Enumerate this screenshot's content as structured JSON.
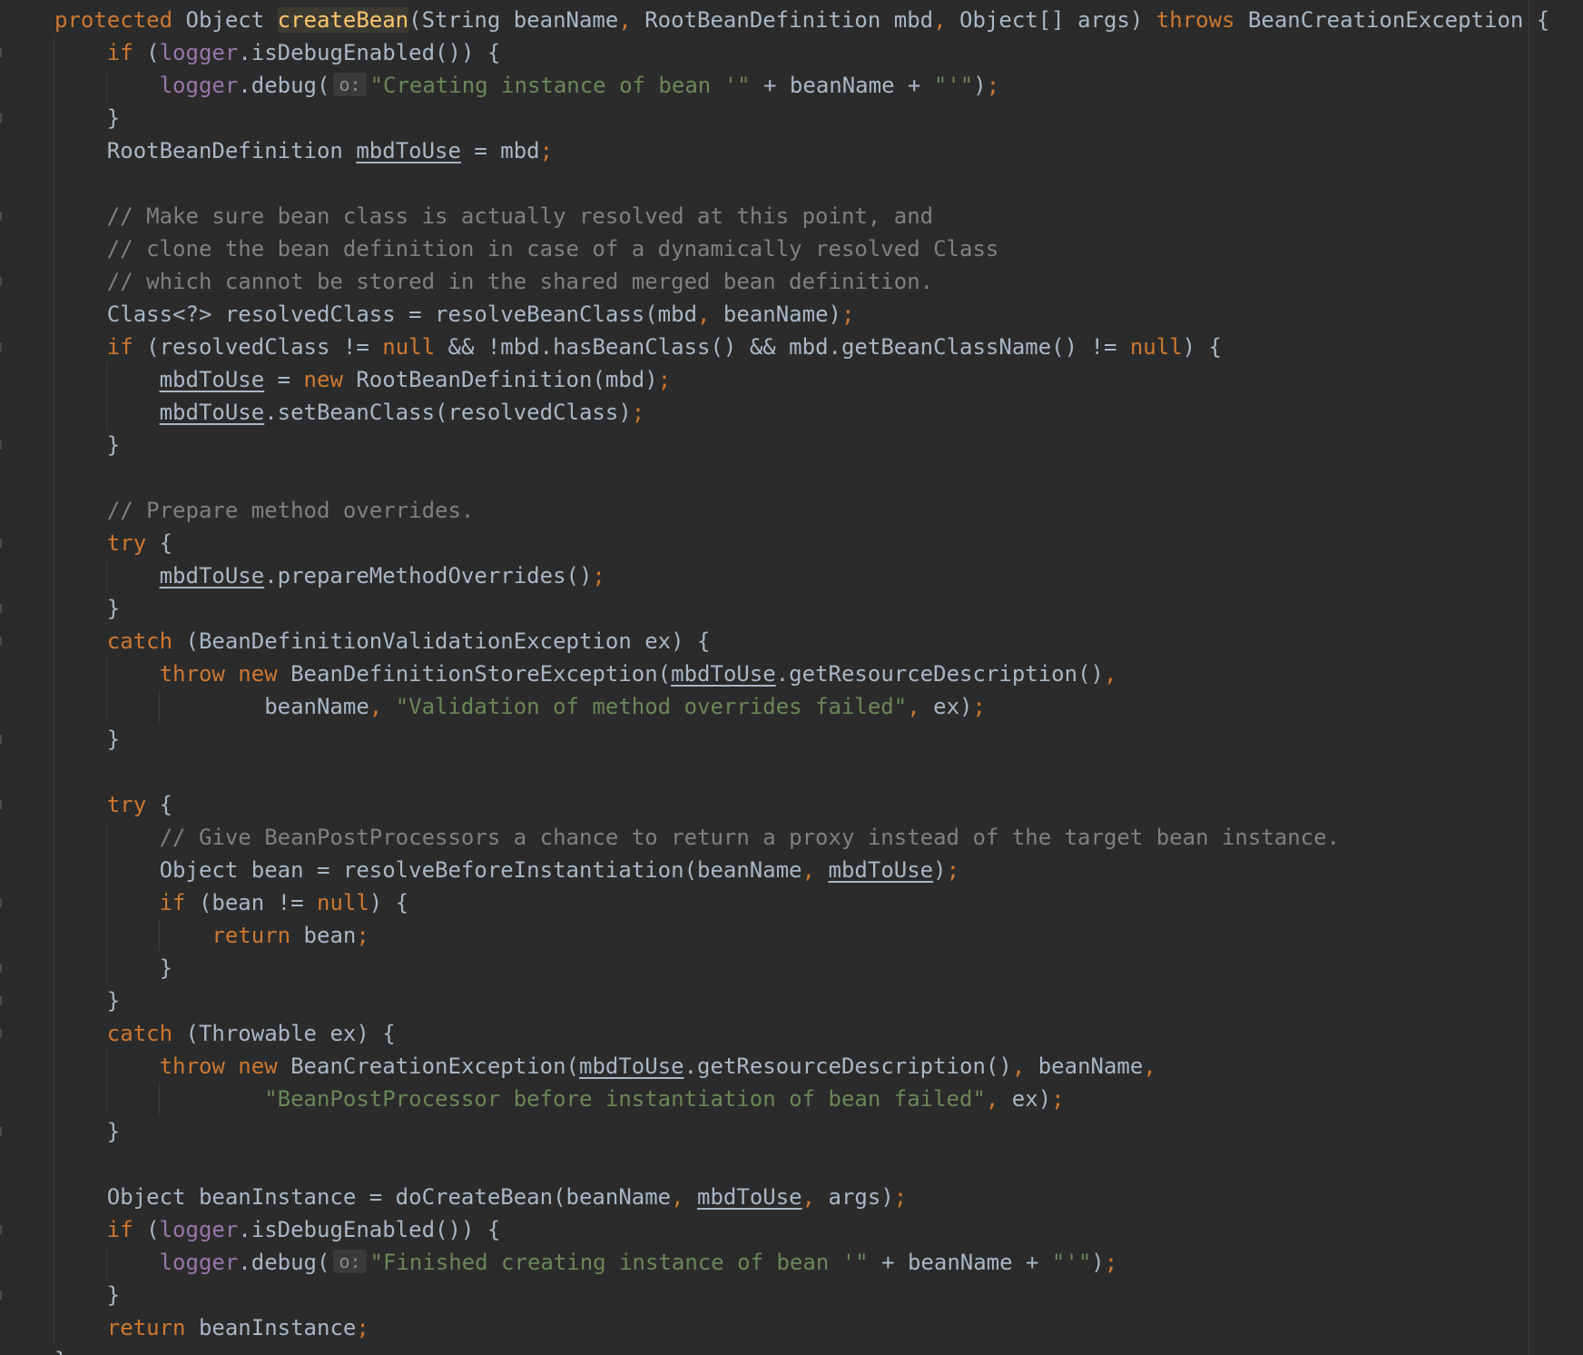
{
  "editor": {
    "language": "java",
    "theme_colors": {
      "background": "#2b2b2b",
      "keyword": "#cc7832",
      "string": "#6a8759",
      "comment": "#808080",
      "field": "#9876aa",
      "method_declaration": "#ffc66d",
      "default_text": "#a9b7c6"
    },
    "lines": [
      {
        "indent": 0,
        "guides": [],
        "fold": false,
        "tokens": [
          {
            "t": "protected",
            "c": "kw"
          },
          {
            "t": " Object "
          },
          {
            "t": "createBean",
            "c": "fn-hl"
          },
          {
            "t": "(String beanName"
          },
          {
            "t": ",",
            "c": "kw"
          },
          {
            "t": " RootBeanDefinition mbd"
          },
          {
            "t": ",",
            "c": "kw"
          },
          {
            "t": " Object[] args) "
          },
          {
            "t": "throws",
            "c": "kw"
          },
          {
            "t": " BeanCreationException {"
          }
        ]
      },
      {
        "indent": 4,
        "guides": [
          0
        ],
        "fold": true,
        "tokens": [
          {
            "t": "if",
            "c": "kw"
          },
          {
            "t": " ("
          },
          {
            "t": "logger",
            "c": "fld"
          },
          {
            "t": ".isDebugEnabled()) {"
          }
        ]
      },
      {
        "indent": 8,
        "guides": [
          0,
          4
        ],
        "fold": false,
        "tokens": [
          {
            "t": "logger",
            "c": "fld"
          },
          {
            "t": ".debug("
          },
          {
            "t": "o:",
            "c": "hint"
          },
          {
            "t": "\"Creating instance of bean '\"",
            "c": "str"
          },
          {
            "t": " + beanName + "
          },
          {
            "t": "\"'\"",
            "c": "str"
          },
          {
            "t": ")"
          },
          {
            "t": ";",
            "c": "kw"
          }
        ]
      },
      {
        "indent": 4,
        "guides": [
          0
        ],
        "fold": true,
        "tokens": [
          {
            "t": "}"
          }
        ]
      },
      {
        "indent": 4,
        "guides": [
          0
        ],
        "fold": false,
        "tokens": [
          {
            "t": "RootBeanDefinition "
          },
          {
            "t": "mbdToUse",
            "c": "ref"
          },
          {
            "t": " = mbd"
          },
          {
            "t": ";",
            "c": "kw"
          }
        ]
      },
      {
        "indent": 0,
        "guides": [
          0
        ],
        "fold": false,
        "tokens": []
      },
      {
        "indent": 4,
        "guides": [
          0
        ],
        "fold": true,
        "tokens": [
          {
            "t": "// Make sure bean class is actually resolved at this point, and",
            "c": "cmt"
          }
        ]
      },
      {
        "indent": 4,
        "guides": [
          0
        ],
        "fold": false,
        "tokens": [
          {
            "t": "// clone the bean definition in case of a dynamically resolved Class",
            "c": "cmt"
          }
        ]
      },
      {
        "indent": 4,
        "guides": [
          0
        ],
        "fold": true,
        "tokens": [
          {
            "t": "// which cannot be stored in the shared merged bean definition.",
            "c": "cmt"
          }
        ]
      },
      {
        "indent": 4,
        "guides": [
          0
        ],
        "fold": false,
        "tokens": [
          {
            "t": "Class<?> resolvedClass = resolveBeanClass(mbd"
          },
          {
            "t": ",",
            "c": "kw"
          },
          {
            "t": " beanName)"
          },
          {
            "t": ";",
            "c": "kw"
          }
        ]
      },
      {
        "indent": 4,
        "guides": [
          0
        ],
        "fold": true,
        "tokens": [
          {
            "t": "if",
            "c": "kw"
          },
          {
            "t": " (resolvedClass != "
          },
          {
            "t": "null",
            "c": "kw"
          },
          {
            "t": " && !mbd.hasBeanClass() && mbd.getBeanClassName() != "
          },
          {
            "t": "null",
            "c": "kw"
          },
          {
            "t": ") {"
          }
        ]
      },
      {
        "indent": 8,
        "guides": [
          0,
          4
        ],
        "fold": false,
        "tokens": [
          {
            "t": "mbdToUse",
            "c": "ref"
          },
          {
            "t": " = "
          },
          {
            "t": "new",
            "c": "kw"
          },
          {
            "t": " RootBeanDefinition(mbd)"
          },
          {
            "t": ";",
            "c": "kw"
          }
        ]
      },
      {
        "indent": 8,
        "guides": [
          0,
          4
        ],
        "fold": false,
        "tokens": [
          {
            "t": "mbdToUse",
            "c": "ref"
          },
          {
            "t": ".setBeanClass(resolvedClass)"
          },
          {
            "t": ";",
            "c": "kw"
          }
        ]
      },
      {
        "indent": 4,
        "guides": [
          0
        ],
        "fold": true,
        "tokens": [
          {
            "t": "}"
          }
        ]
      },
      {
        "indent": 0,
        "guides": [
          0
        ],
        "fold": false,
        "tokens": []
      },
      {
        "indent": 4,
        "guides": [
          0
        ],
        "fold": false,
        "tokens": [
          {
            "t": "// Prepare method overrides.",
            "c": "cmt"
          }
        ]
      },
      {
        "indent": 4,
        "guides": [
          0
        ],
        "fold": true,
        "tokens": [
          {
            "t": "try",
            "c": "kw"
          },
          {
            "t": " {"
          }
        ]
      },
      {
        "indent": 8,
        "guides": [
          0,
          4
        ],
        "fold": false,
        "tokens": [
          {
            "t": "mbdToUse",
            "c": "ref"
          },
          {
            "t": ".prepareMethodOverrides()"
          },
          {
            "t": ";",
            "c": "kw"
          }
        ]
      },
      {
        "indent": 4,
        "guides": [
          0
        ],
        "fold": true,
        "tokens": [
          {
            "t": "}"
          }
        ]
      },
      {
        "indent": 4,
        "guides": [
          0
        ],
        "fold": true,
        "tokens": [
          {
            "t": "catch",
            "c": "kw"
          },
          {
            "t": " (BeanDefinitionValidationException ex) {"
          }
        ]
      },
      {
        "indent": 8,
        "guides": [
          0,
          4
        ],
        "fold": false,
        "tokens": [
          {
            "t": "throw",
            "c": "kw"
          },
          {
            "t": " "
          },
          {
            "t": "new",
            "c": "kw"
          },
          {
            "t": " BeanDefinitionStoreException("
          },
          {
            "t": "mbdToUse",
            "c": "ref"
          },
          {
            "t": ".getResourceDescription()"
          },
          {
            "t": ",",
            "c": "kw"
          }
        ]
      },
      {
        "indent": 16,
        "guides": [
          0,
          4,
          8
        ],
        "fold": false,
        "tokens": [
          {
            "t": "beanName"
          },
          {
            "t": ",",
            "c": "kw"
          },
          {
            "t": " "
          },
          {
            "t": "\"Validation of method overrides failed\"",
            "c": "str"
          },
          {
            "t": ",",
            "c": "kw"
          },
          {
            "t": " ex)"
          },
          {
            "t": ";",
            "c": "kw"
          }
        ]
      },
      {
        "indent": 4,
        "guides": [
          0
        ],
        "fold": true,
        "tokens": [
          {
            "t": "}"
          }
        ]
      },
      {
        "indent": 0,
        "guides": [
          0
        ],
        "fold": false,
        "tokens": []
      },
      {
        "indent": 4,
        "guides": [
          0
        ],
        "fold": true,
        "tokens": [
          {
            "t": "try",
            "c": "kw"
          },
          {
            "t": " {"
          }
        ]
      },
      {
        "indent": 8,
        "guides": [
          0,
          4
        ],
        "fold": false,
        "tokens": [
          {
            "t": "// Give BeanPostProcessors a chance to return a proxy instead of the target bean instance.",
            "c": "cmt"
          }
        ]
      },
      {
        "indent": 8,
        "guides": [
          0,
          4
        ],
        "fold": false,
        "tokens": [
          {
            "t": "Object bean = resolveBeforeInstantiation(beanName"
          },
          {
            "t": ",",
            "c": "kw"
          },
          {
            "t": " "
          },
          {
            "t": "mbdToUse",
            "c": "ref"
          },
          {
            "t": ")"
          },
          {
            "t": ";",
            "c": "kw"
          }
        ]
      },
      {
        "indent": 8,
        "guides": [
          0,
          4
        ],
        "fold": true,
        "tokens": [
          {
            "t": "if",
            "c": "kw"
          },
          {
            "t": " (bean != "
          },
          {
            "t": "null",
            "c": "kw"
          },
          {
            "t": ") {"
          }
        ]
      },
      {
        "indent": 12,
        "guides": [
          0,
          4,
          8
        ],
        "fold": false,
        "tokens": [
          {
            "t": "return",
            "c": "kw"
          },
          {
            "t": " bean"
          },
          {
            "t": ";",
            "c": "kw"
          }
        ]
      },
      {
        "indent": 8,
        "guides": [
          0,
          4
        ],
        "fold": true,
        "tokens": [
          {
            "t": "}"
          }
        ]
      },
      {
        "indent": 4,
        "guides": [
          0
        ],
        "fold": true,
        "tokens": [
          {
            "t": "}"
          }
        ]
      },
      {
        "indent": 4,
        "guides": [
          0
        ],
        "fold": true,
        "tokens": [
          {
            "t": "catch",
            "c": "kw"
          },
          {
            "t": " (Throwable ex) {"
          }
        ]
      },
      {
        "indent": 8,
        "guides": [
          0,
          4
        ],
        "fold": false,
        "tokens": [
          {
            "t": "throw",
            "c": "kw"
          },
          {
            "t": " "
          },
          {
            "t": "new",
            "c": "kw"
          },
          {
            "t": " BeanCreationException("
          },
          {
            "t": "mbdToUse",
            "c": "ref"
          },
          {
            "t": ".getResourceDescription()"
          },
          {
            "t": ",",
            "c": "kw"
          },
          {
            "t": " beanName"
          },
          {
            "t": ",",
            "c": "kw"
          }
        ]
      },
      {
        "indent": 16,
        "guides": [
          0,
          4,
          8
        ],
        "fold": false,
        "tokens": [
          {
            "t": "\"BeanPostProcessor before instantiation of bean failed\"",
            "c": "str"
          },
          {
            "t": ",",
            "c": "kw"
          },
          {
            "t": " ex)"
          },
          {
            "t": ";",
            "c": "kw"
          }
        ]
      },
      {
        "indent": 4,
        "guides": [
          0
        ],
        "fold": true,
        "tokens": [
          {
            "t": "}"
          }
        ]
      },
      {
        "indent": 0,
        "guides": [
          0
        ],
        "fold": false,
        "tokens": []
      },
      {
        "indent": 4,
        "guides": [
          0
        ],
        "fold": false,
        "tokens": [
          {
            "t": "Object beanInstance = doCreateBean(beanName"
          },
          {
            "t": ",",
            "c": "kw"
          },
          {
            "t": " "
          },
          {
            "t": "mbdToUse",
            "c": "ref"
          },
          {
            "t": ",",
            "c": "kw"
          },
          {
            "t": " args)"
          },
          {
            "t": ";",
            "c": "kw"
          }
        ]
      },
      {
        "indent": 4,
        "guides": [
          0
        ],
        "fold": true,
        "tokens": [
          {
            "t": "if",
            "c": "kw"
          },
          {
            "t": " ("
          },
          {
            "t": "logger",
            "c": "fld"
          },
          {
            "t": ".isDebugEnabled()) {"
          }
        ]
      },
      {
        "indent": 8,
        "guides": [
          0,
          4
        ],
        "fold": false,
        "tokens": [
          {
            "t": "logger",
            "c": "fld"
          },
          {
            "t": ".debug("
          },
          {
            "t": "o:",
            "c": "hint"
          },
          {
            "t": "\"Finished creating instance of bean '\"",
            "c": "str"
          },
          {
            "t": " + beanName + "
          },
          {
            "t": "\"'\"",
            "c": "str"
          },
          {
            "t": ")"
          },
          {
            "t": ";",
            "c": "kw"
          }
        ]
      },
      {
        "indent": 4,
        "guides": [
          0
        ],
        "fold": true,
        "tokens": [
          {
            "t": "}"
          }
        ]
      },
      {
        "indent": 4,
        "guides": [
          0
        ],
        "fold": false,
        "tokens": [
          {
            "t": "return",
            "c": "kw"
          },
          {
            "t": " beanInstance"
          },
          {
            "t": ";",
            "c": "kw"
          }
        ]
      },
      {
        "indent": 0,
        "guides": [],
        "fold": false,
        "tokens": [
          {
            "t": "}"
          }
        ]
      }
    ]
  }
}
